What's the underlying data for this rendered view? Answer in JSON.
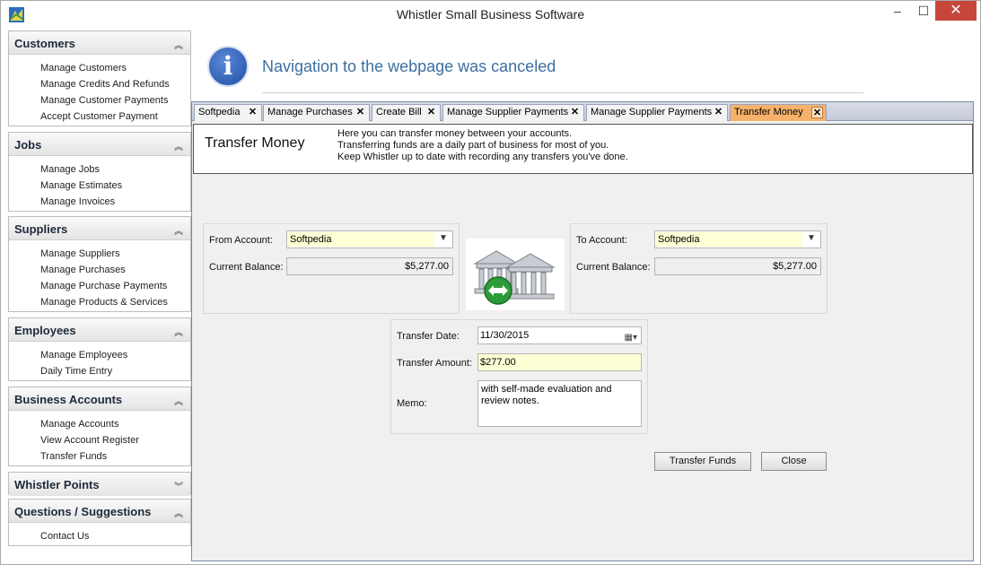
{
  "window": {
    "title": "Whistler Small  Business Software",
    "min": "–",
    "max": "☐",
    "close": "✕"
  },
  "sidebar": {
    "sections": [
      {
        "label": "Customers",
        "chevron": "»",
        "items": [
          "Manage Customers",
          "Manage Credits And Refunds",
          "Manage Customer Payments",
          "Accept Customer Payment"
        ]
      },
      {
        "label": "Jobs",
        "chevron": "»",
        "items": [
          "Manage Jobs",
          "Manage Estimates",
          "Manage Invoices"
        ]
      },
      {
        "label": "Suppliers",
        "chevron": "»",
        "items": [
          "Manage Suppliers",
          "Manage Purchases",
          "Manage Purchase Payments",
          "Manage Products & Services"
        ]
      },
      {
        "label": "Employees",
        "chevron": "»",
        "items": [
          "Manage Employees",
          "Daily Time Entry"
        ]
      },
      {
        "label": "Business Accounts",
        "chevron": "»",
        "items": [
          "Manage Accounts",
          "View Account Register",
          "Transfer Funds"
        ]
      },
      {
        "label": "Whistler Points",
        "chevron": "»",
        "items": []
      },
      {
        "label": "Questions / Suggestions",
        "chevron": "»",
        "items": [
          "Contact Us"
        ]
      }
    ]
  },
  "info": {
    "icon": "info-icon",
    "message": "Navigation to the webpage was canceled"
  },
  "tabs": [
    {
      "label": "Softpedia",
      "active": false
    },
    {
      "label": "Manage Purchases",
      "active": false
    },
    {
      "label": "Create Bill",
      "active": false
    },
    {
      "label": "Manage Supplier Payments",
      "active": false
    },
    {
      "label": "Manage Supplier Payments",
      "active": false
    },
    {
      "label": "Transfer Money",
      "active": true
    }
  ],
  "header": {
    "title": "Transfer Money",
    "lines": [
      "Here you can transfer money between your accounts.",
      "Transferring funds are a daily part of business for most of you.",
      "Keep Whistler up to date with recording any transfers you've done."
    ]
  },
  "from": {
    "account_label": "From Account:",
    "account_value": "Softpedia",
    "balance_label": "Current Balance:",
    "balance_value": "$5,277.00"
  },
  "to": {
    "account_label": "To Account:",
    "account_value": "Softpedia",
    "balance_label": "Current Balance:",
    "balance_value": "$5,277.00"
  },
  "transfer": {
    "date_label": "Transfer Date:",
    "date_value": "11/30/2015",
    "amount_label": "Transfer Amount:",
    "amount_value": "$277.00",
    "memo_label": "Memo:",
    "memo_value": "with self-made evaluation and review notes."
  },
  "buttons": {
    "transfer": "Transfer Funds",
    "close": "Close"
  },
  "colors": {
    "active_tab": "#f8b16a",
    "input_highlight": "#ffffd5",
    "close_button": "#c7463c"
  }
}
